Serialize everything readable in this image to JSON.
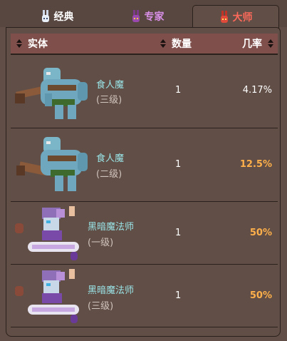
{
  "tabs": [
    {
      "label": "经典",
      "color": "#ffffff",
      "icon": "white-bunny-icon",
      "active": false
    },
    {
      "label": "专家",
      "color": "#d990e8",
      "icon": "purple-bunny-icon",
      "active": false
    },
    {
      "label": "大师",
      "color": "#ff6a5a",
      "icon": "red-bunny-icon",
      "active": true
    }
  ],
  "table": {
    "columns": {
      "entity": "实体",
      "quantity": "数量",
      "chance": "几率"
    },
    "rows": [
      {
        "name": "食人魔",
        "tier": "(三级)",
        "quantity": "1",
        "chance": "4.17%",
        "highlight": false,
        "sprite": "ogre-icon"
      },
      {
        "name": "食人魔",
        "tier": "(二级)",
        "quantity": "1",
        "chance": "12.5%",
        "highlight": true,
        "sprite": "ogre-icon"
      },
      {
        "name": "黑暗魔法师",
        "tier": "(一级)",
        "quantity": "1",
        "chance": "50%",
        "highlight": true,
        "sprite": "dark-mage-icon"
      },
      {
        "name": "黑暗魔法师",
        "tier": "(三级)",
        "quantity": "1",
        "chance": "50%",
        "highlight": true,
        "sprite": "dark-mage-icon"
      }
    ]
  },
  "colors": {
    "name": "#99e3e6",
    "highlight": "#ffb04a",
    "header_bg": "#7f4f4b",
    "bg": "#614e46"
  }
}
